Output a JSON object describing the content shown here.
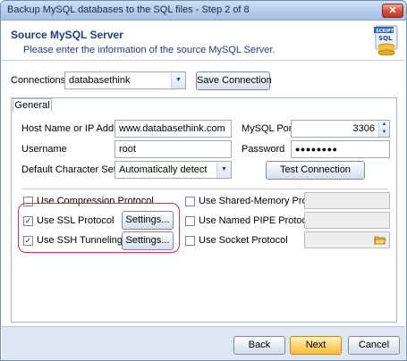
{
  "window": {
    "title": "Backup MySQL databases to the SQL files - Step 2 of 8",
    "close_symbol": "✕"
  },
  "header": {
    "title": "Source MySQL Server",
    "subtitle": "Please enter the information of the source MySQL Server.",
    "logo_text": "SCRIPT SQL"
  },
  "connections": {
    "label": "Connections",
    "value": "databasethink",
    "save_button": "Save Connection"
  },
  "tabs": [
    {
      "label": "General"
    }
  ],
  "general": {
    "host_label": "Host Name or IP Address",
    "host_value": "www.databasethink.com",
    "port_label": "MySQL Port",
    "port_value": "3306",
    "username_label": "Username",
    "username_value": "root",
    "password_label": "Password",
    "password_value": "●●●●●●●●",
    "charset_label": "Default Character Set",
    "charset_value": "Automatically detect",
    "test_button": "Test Connection"
  },
  "options": {
    "compression": {
      "label": "Use Compression Protocol",
      "checked": false
    },
    "ssl": {
      "label": "Use SSL Protocol",
      "checked": true,
      "settings_button": "Settings..."
    },
    "ssh": {
      "label": "Use SSH Tunneling",
      "checked": true,
      "settings_button": "Settings..."
    },
    "shared_memory": {
      "label": "Use Shared-Memory Protocol",
      "checked": false
    },
    "named_pipe": {
      "label": "Use Named PIPE Protocol",
      "checked": false
    },
    "socket": {
      "label": "Use Socket Protocol",
      "checked": false
    }
  },
  "footer": {
    "back": "Back",
    "next": "Next",
    "cancel": "Cancel"
  },
  "colors": {
    "header_text": "#1f3d7a",
    "highlight": "#d62d3e",
    "footer_bg": "#dde6f2"
  }
}
